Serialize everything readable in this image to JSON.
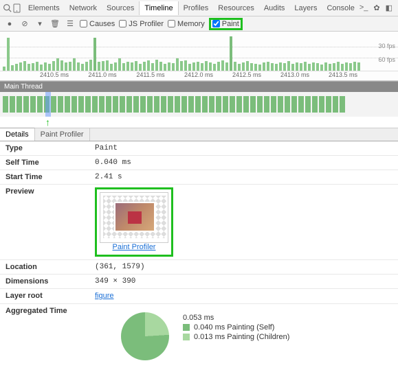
{
  "topTabs": [
    "Elements",
    "Network",
    "Sources",
    "Timeline",
    "Profiles",
    "Resources",
    "Audits",
    "Layers",
    "Console"
  ],
  "topTabSelected": "Timeline",
  "toolbar": {
    "causes": "Causes",
    "jsprofiler": "JS Profiler",
    "memory": "Memory",
    "paint": "Paint"
  },
  "fps": {
    "line1": "30 fps",
    "line2": "60 fps"
  },
  "axis": [
    "2410.5 ms",
    "2411.0 ms",
    "2411.5 ms",
    "2412.0 ms",
    "2412.5 ms",
    "2413.0 ms",
    "2413.5 ms"
  ],
  "minimapTitle": "Main Thread",
  "detailsTabs": {
    "details": "Details",
    "paintprofiler": "Paint Profiler"
  },
  "rows": {
    "type": {
      "label": "Type",
      "value": "Paint"
    },
    "selftime": {
      "label": "Self Time",
      "value": "0.040 ms"
    },
    "starttime": {
      "label": "Start Time",
      "value": "2.41 s"
    },
    "preview": {
      "label": "Preview",
      "caption": "",
      "link": "Paint Profiler"
    },
    "location": {
      "label": "Location",
      "value": "(361, 1579)"
    },
    "dimensions": {
      "label": "Dimensions",
      "value": "349 × 390"
    },
    "layerroot": {
      "label": "Layer root",
      "value": "figure"
    },
    "aggtime": {
      "label": "Aggregated Time",
      "total": "0.053 ms",
      "items": [
        {
          "text": "0.040 ms Painting (Self)",
          "color": "#7bbd7b"
        },
        {
          "text": "0.013 ms Painting (Children)",
          "color": "#a8d8a0"
        }
      ]
    }
  },
  "chart_data": {
    "type": "pie",
    "title": "Aggregated Time",
    "categories": [
      "Painting (Self)",
      "Painting (Children)"
    ],
    "values": [
      0.04,
      0.013
    ],
    "total": 0.053,
    "unit": "ms",
    "colors": [
      "#7bbd7b",
      "#a8d8a0"
    ]
  }
}
